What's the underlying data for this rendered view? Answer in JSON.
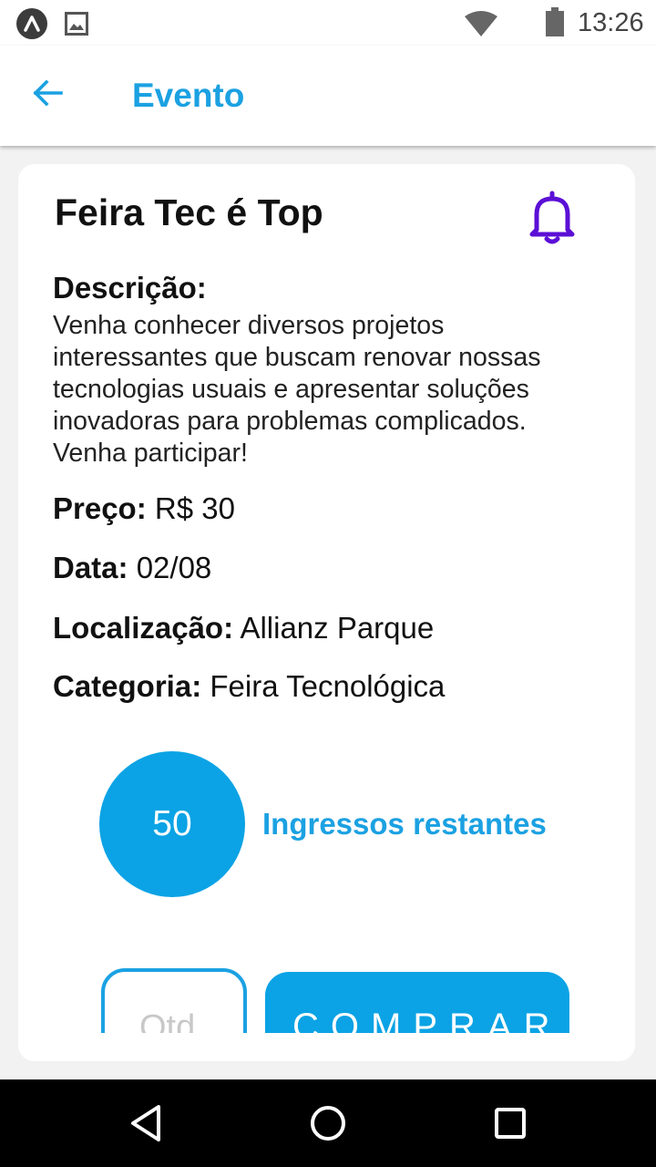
{
  "status_bar": {
    "time": "13:26",
    "icons": [
      "app-notification-icon",
      "image-notification-icon",
      "wifi-icon",
      "battery-icon"
    ]
  },
  "app_bar": {
    "title": "Evento",
    "back_icon": "arrow-left-icon",
    "accent_color": "#1ba1e2"
  },
  "event": {
    "title": "Feira Tec é Top",
    "bell_icon": "bell-icon",
    "bell_color": "#5b0fd6",
    "description_label": "Descrição:",
    "description": "Venha conhecer diversos projetos interessantes que buscam renovar nossas tecnologias usuais e apresentar soluções inovadoras para problemas complicados. Venha participar!",
    "price_label": "Preço:",
    "price": "R$ 30",
    "date_label": "Data:",
    "date": "02/08",
    "location_label": "Localização:",
    "location": "Allianz Parque",
    "category_label": "Categoria:",
    "category": "Feira Tecnológica"
  },
  "tickets": {
    "count": "50",
    "label": "Ingressos restantes",
    "circle_color": "#0ba3e5"
  },
  "purchase": {
    "quantity_placeholder": "Qtd",
    "buy_label": "COMPRAR"
  },
  "nav_bar": {
    "icons": [
      "back-triangle-icon",
      "home-circle-icon",
      "recents-square-icon"
    ]
  }
}
